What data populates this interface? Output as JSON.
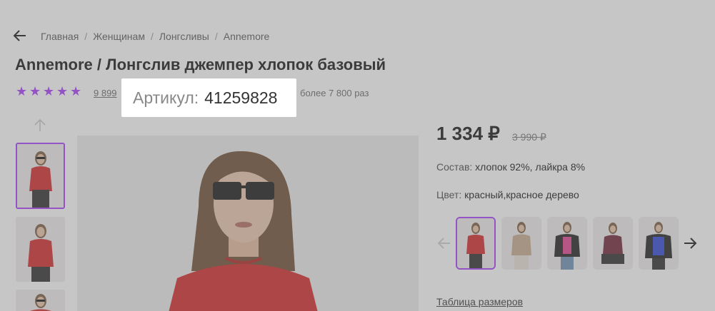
{
  "breadcrumb": {
    "items": [
      "Главная",
      "Женщинам",
      "Лонгсливы",
      "Annemore"
    ],
    "separator": "/"
  },
  "product": {
    "title": "Annemore / Лонгслив джемпер хлопок базовый",
    "rating": 5,
    "reviews": "9 899",
    "bought": "более 7 800 раз",
    "article_label": "Артикул:",
    "article_number": "41259828",
    "price": "1 334 ₽",
    "old_price": "3 990 ₽",
    "composition_label": "Состав:",
    "composition_value": "хлопок 92%, лайкра 8%",
    "color_label": "Цвет:",
    "color_value": "красный,красное дерево",
    "size_table_label": "Таблица размеров"
  },
  "colors": {
    "accent": "#a73afd",
    "sweater_red": "#d42424"
  },
  "color_variants": [
    "red",
    "beige",
    "pink",
    "burgundy",
    "blue"
  ],
  "icons": {
    "back": "arrow-left-icon",
    "up": "chevron-up-icon",
    "prev": "arrow-left-icon",
    "next": "arrow-right-icon",
    "star": "star-icon"
  }
}
